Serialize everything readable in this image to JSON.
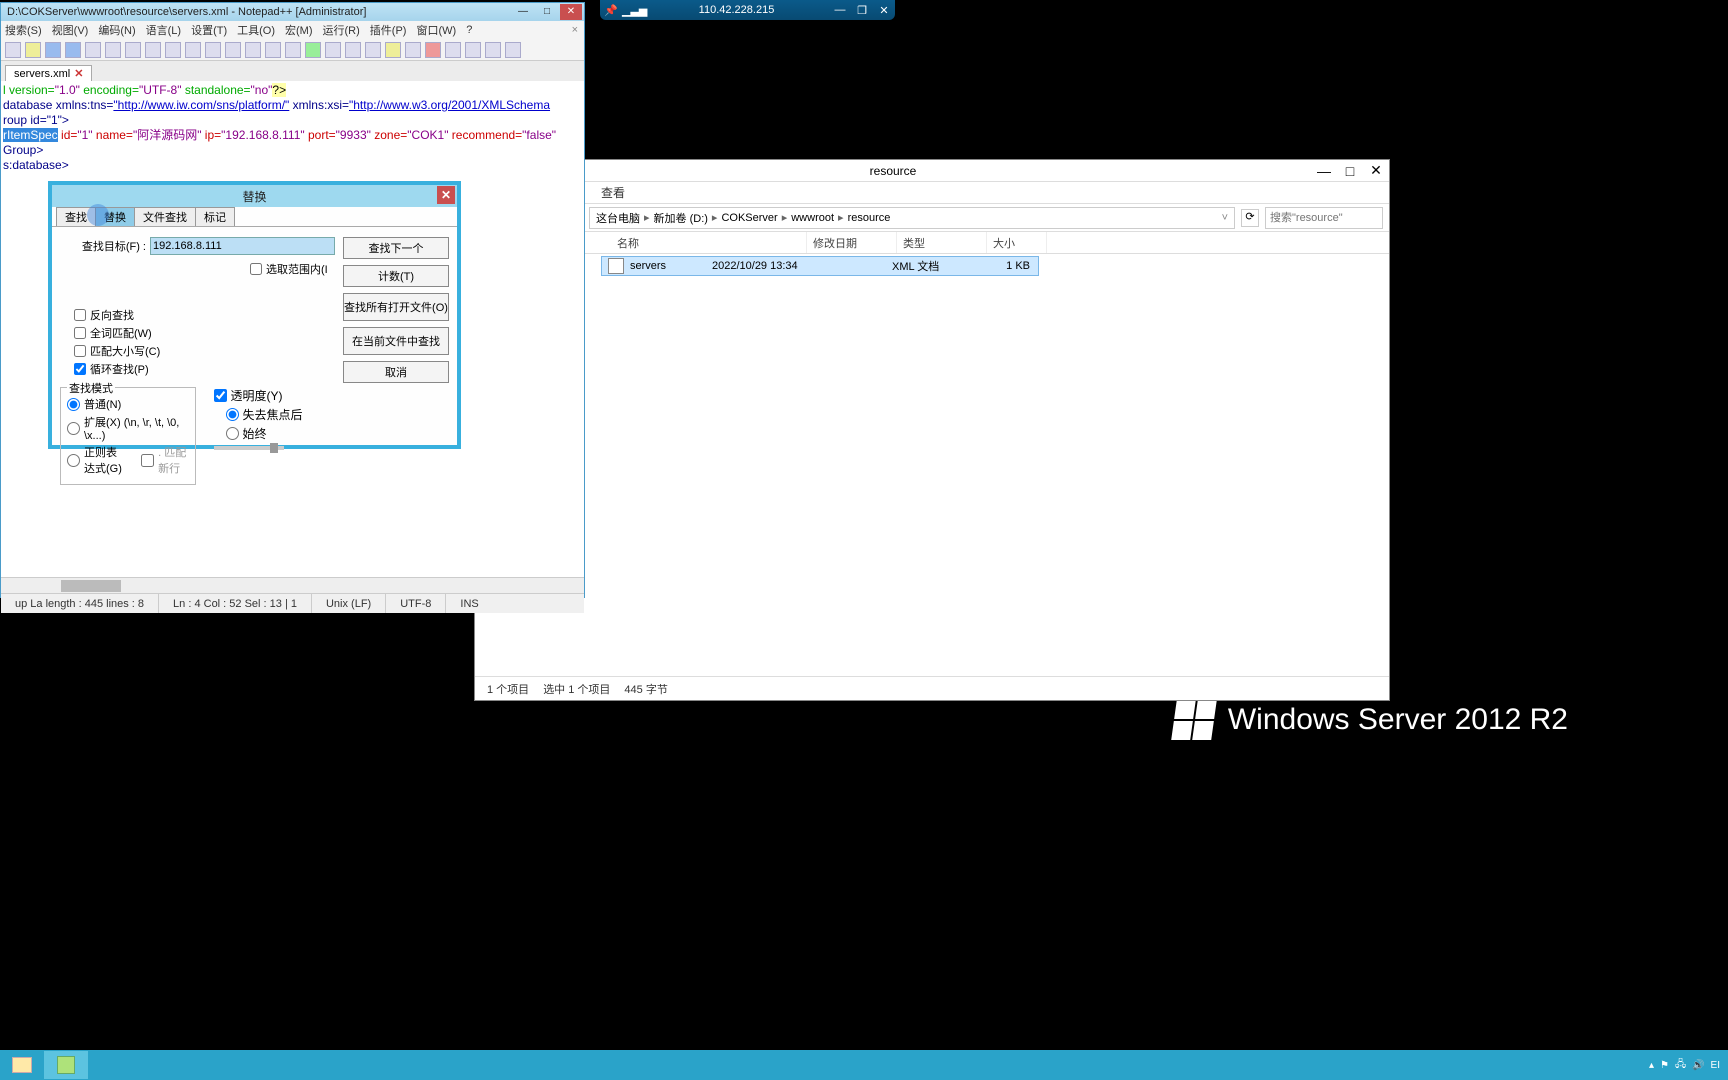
{
  "rdp": {
    "address": "110.42.228.215"
  },
  "npp": {
    "title": "D:\\COKServer\\wwwroot\\resource\\servers.xml - Notepad++ [Administrator]",
    "menu": {
      "search": "搜索(S)",
      "view": "视图(V)",
      "encoding": "编码(N)",
      "lang": "语言(L)",
      "settings": "设置(T)",
      "tools": "工具(O)",
      "macro": "宏(M)",
      "run": "运行(R)",
      "plugins": "插件(P)",
      "window": "窗口(W)",
      "help": "?"
    },
    "tab": "servers.xml",
    "code": {
      "l1a": "l version=",
      "l1v": "\"1.0\"",
      "l1b": " encoding=",
      "l1e": "\"UTF-8\"",
      "l1c": " standalone=",
      "l1s": "\"no\"",
      "l1end": "?>",
      "l2a": "database xmlns:tns=",
      "l2u1": "\"http://www.iw.com/sns/platform/\"",
      "l2b": " xmlns:xsi=",
      "l2u2": "\"http://www.w3.org/2001/XMLSchema",
      "l3": "roup id=\"1\">",
      "l4a": "rItemSpec",
      "l4b": " id=",
      "l4id": "\"1\"",
      "l4c": " name=",
      "l4nm": "\"阿洋源码网\"",
      "l4d": " ip=",
      "l4ip": "\"192.168.8.111\"",
      "l4e": " port=",
      "l4pt": "\"9933\"",
      "l4f": " zone=",
      "l4zn": "\"COK1\"",
      "l4g": " recommend=",
      "l4rc": "\"false\"",
      "l5": "Group>",
      "l6": "s:database>"
    },
    "status": {
      "length": "up La length : 445   lines : 8",
      "pos": "Ln : 4   Col : 52   Sel : 13 | 1",
      "eol": "Unix (LF)",
      "enc": "UTF-8",
      "ins": "INS"
    }
  },
  "dlg": {
    "title": "替换",
    "tabs": {
      "find": "查找",
      "replace": "替换",
      "infiles": "文件查找",
      "mark": "标记"
    },
    "find_label": "查找目标(F) :",
    "find_value": "192.168.8.111",
    "cb_range": "选取范围内(I",
    "cb_back": "反向查找",
    "cb_word": "全词匹配(W)",
    "cb_case": "匹配大小写(C)",
    "cb_wrap": "循环查找(P)",
    "grp_mode": "查找模式",
    "rb_normal": "普通(N)",
    "rb_ext": "扩展(X) (\\n, \\r, \\t, \\0, \\x...)",
    "rb_regex": "正则表达式(G)",
    "cb_dotnl": ". 匹配新行",
    "grp_trans": "透明度(Y)",
    "rb_blur": "失去焦点后",
    "rb_always": "始终",
    "btn_next": "查找下一个",
    "btn_count": "计数(T)",
    "btn_all": "查找所有打开文件(O)",
    "btn_cur": "在当前文件中查找",
    "btn_cancel": "取消"
  },
  "exp": {
    "title": "resource",
    "menu_view": "查看",
    "crumbs": {
      "pc": "这台电脑",
      "d": "新加卷 (D:)",
      "cok": "COKServer",
      "www": "wwwroot",
      "res": "resource"
    },
    "search_ph": "搜索\"resource\"",
    "hdr": {
      "name": "名称",
      "date": "修改日期",
      "type": "类型",
      "size": "大小"
    },
    "row": {
      "name": "servers",
      "date": "2022/10/29 13:34",
      "type": "XML 文档",
      "size": "1 KB"
    },
    "status": {
      "count": "1 个项目",
      "sel": "选中 1 个项目",
      "bytes": "445 字节"
    }
  },
  "brand": "Windows Server 2012 R2",
  "tray": {
    "lang": "EI"
  }
}
